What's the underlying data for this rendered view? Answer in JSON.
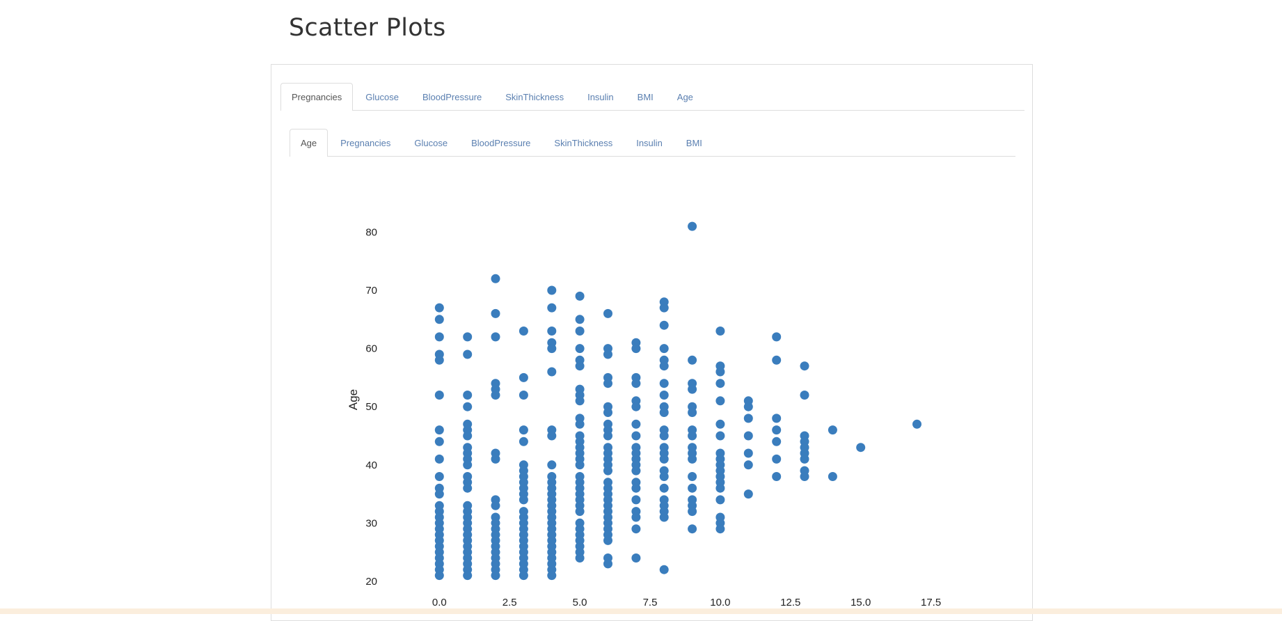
{
  "page": {
    "title": "Scatter Plots"
  },
  "outer_tabs": [
    {
      "label": "Pregnancies",
      "active": true
    },
    {
      "label": "Glucose",
      "active": false
    },
    {
      "label": "BloodPressure",
      "active": false
    },
    {
      "label": "SkinThickness",
      "active": false
    },
    {
      "label": "Insulin",
      "active": false
    },
    {
      "label": "BMI",
      "active": false
    },
    {
      "label": "Age",
      "active": false
    }
  ],
  "inner_tabs": [
    {
      "label": "Age",
      "active": true
    },
    {
      "label": "Pregnancies",
      "active": false
    },
    {
      "label": "Glucose",
      "active": false
    },
    {
      "label": "BloodPressure",
      "active": false
    },
    {
      "label": "SkinThickness",
      "active": false
    },
    {
      "label": "Insulin",
      "active": false
    },
    {
      "label": "BMI",
      "active": false
    }
  ],
  "colors": {
    "point": "#3a7dbd",
    "tab_link": "#5a7fb0",
    "bottom_strip": "#fbeedd"
  },
  "chart_data": {
    "type": "scatter",
    "title": "",
    "xlabel": "",
    "ylabel": "Age",
    "xlim": [
      -0.9,
      18.5
    ],
    "ylim": [
      17,
      84
    ],
    "x_ticks": [
      "0.0",
      "2.5",
      "5.0",
      "7.5",
      "10.0",
      "12.5",
      "15.0",
      "17.5"
    ],
    "x_tick_values": [
      0,
      2.5,
      5,
      7.5,
      10,
      12.5,
      15,
      17.5
    ],
    "y_ticks": [
      "20",
      "30",
      "40",
      "50",
      "60",
      "70",
      "80"
    ],
    "y_tick_values": [
      20,
      30,
      40,
      50,
      60,
      70,
      80
    ],
    "grid": false,
    "series": [
      {
        "points": [
          [
            0,
            67
          ],
          [
            0,
            65
          ],
          [
            0,
            62
          ],
          [
            0,
            59
          ],
          [
            0,
            58
          ],
          [
            0,
            52
          ],
          [
            0,
            46
          ],
          [
            0,
            44
          ],
          [
            0,
            41
          ],
          [
            0,
            38
          ],
          [
            0,
            36
          ],
          [
            0,
            35
          ],
          [
            0,
            33
          ],
          [
            0,
            32
          ],
          [
            0,
            31
          ],
          [
            0,
            30
          ],
          [
            0,
            29
          ],
          [
            0,
            28
          ],
          [
            0,
            27
          ],
          [
            0,
            26
          ],
          [
            0,
            25
          ],
          [
            0,
            24
          ],
          [
            0,
            23
          ],
          [
            0,
            22
          ],
          [
            0,
            21
          ],
          [
            1,
            62
          ],
          [
            1,
            59
          ],
          [
            1,
            52
          ],
          [
            1,
            50
          ],
          [
            1,
            47
          ],
          [
            1,
            46
          ],
          [
            1,
            45
          ],
          [
            1,
            43
          ],
          [
            1,
            42
          ],
          [
            1,
            41
          ],
          [
            1,
            40
          ],
          [
            1,
            38
          ],
          [
            1,
            37
          ],
          [
            1,
            36
          ],
          [
            1,
            33
          ],
          [
            1,
            32
          ],
          [
            1,
            31
          ],
          [
            1,
            30
          ],
          [
            1,
            29
          ],
          [
            1,
            28
          ],
          [
            1,
            27
          ],
          [
            1,
            26
          ],
          [
            1,
            25
          ],
          [
            1,
            24
          ],
          [
            1,
            23
          ],
          [
            1,
            22
          ],
          [
            1,
            21
          ],
          [
            2,
            72
          ],
          [
            2,
            66
          ],
          [
            2,
            62
          ],
          [
            2,
            54
          ],
          [
            2,
            53
          ],
          [
            2,
            52
          ],
          [
            2,
            42
          ],
          [
            2,
            41
          ],
          [
            2,
            34
          ],
          [
            2,
            33
          ],
          [
            2,
            31
          ],
          [
            2,
            30
          ],
          [
            2,
            29
          ],
          [
            2,
            28
          ],
          [
            2,
            27
          ],
          [
            2,
            26
          ],
          [
            2,
            25
          ],
          [
            2,
            24
          ],
          [
            2,
            23
          ],
          [
            2,
            22
          ],
          [
            2,
            21
          ],
          [
            3,
            63
          ],
          [
            3,
            55
          ],
          [
            3,
            52
          ],
          [
            3,
            46
          ],
          [
            3,
            44
          ],
          [
            3,
            40
          ],
          [
            3,
            39
          ],
          [
            3,
            38
          ],
          [
            3,
            37
          ],
          [
            3,
            36
          ],
          [
            3,
            35
          ],
          [
            3,
            34
          ],
          [
            3,
            32
          ],
          [
            3,
            31
          ],
          [
            3,
            30
          ],
          [
            3,
            29
          ],
          [
            3,
            28
          ],
          [
            3,
            27
          ],
          [
            3,
            26
          ],
          [
            3,
            25
          ],
          [
            3,
            24
          ],
          [
            3,
            23
          ],
          [
            3,
            22
          ],
          [
            3,
            21
          ],
          [
            4,
            70
          ],
          [
            4,
            67
          ],
          [
            4,
            63
          ],
          [
            4,
            61
          ],
          [
            4,
            60
          ],
          [
            4,
            56
          ],
          [
            4,
            46
          ],
          [
            4,
            45
          ],
          [
            4,
            40
          ],
          [
            4,
            38
          ],
          [
            4,
            37
          ],
          [
            4,
            36
          ],
          [
            4,
            35
          ],
          [
            4,
            34
          ],
          [
            4,
            33
          ],
          [
            4,
            32
          ],
          [
            4,
            31
          ],
          [
            4,
            30
          ],
          [
            4,
            29
          ],
          [
            4,
            28
          ],
          [
            4,
            27
          ],
          [
            4,
            26
          ],
          [
            4,
            25
          ],
          [
            4,
            24
          ],
          [
            4,
            23
          ],
          [
            4,
            22
          ],
          [
            4,
            21
          ],
          [
            5,
            69
          ],
          [
            5,
            65
          ],
          [
            5,
            63
          ],
          [
            5,
            60
          ],
          [
            5,
            58
          ],
          [
            5,
            57
          ],
          [
            5,
            53
          ],
          [
            5,
            52
          ],
          [
            5,
            51
          ],
          [
            5,
            48
          ],
          [
            5,
            47
          ],
          [
            5,
            45
          ],
          [
            5,
            44
          ],
          [
            5,
            43
          ],
          [
            5,
            42
          ],
          [
            5,
            41
          ],
          [
            5,
            40
          ],
          [
            5,
            38
          ],
          [
            5,
            37
          ],
          [
            5,
            36
          ],
          [
            5,
            35
          ],
          [
            5,
            34
          ],
          [
            5,
            33
          ],
          [
            5,
            32
          ],
          [
            5,
            30
          ],
          [
            5,
            29
          ],
          [
            5,
            28
          ],
          [
            5,
            27
          ],
          [
            5,
            26
          ],
          [
            5,
            25
          ],
          [
            5,
            24
          ],
          [
            6,
            66
          ],
          [
            6,
            60
          ],
          [
            6,
            59
          ],
          [
            6,
            55
          ],
          [
            6,
            54
          ],
          [
            6,
            50
          ],
          [
            6,
            49
          ],
          [
            6,
            47
          ],
          [
            6,
            46
          ],
          [
            6,
            45
          ],
          [
            6,
            43
          ],
          [
            6,
            42
          ],
          [
            6,
            41
          ],
          [
            6,
            40
          ],
          [
            6,
            39
          ],
          [
            6,
            37
          ],
          [
            6,
            36
          ],
          [
            6,
            35
          ],
          [
            6,
            34
          ],
          [
            6,
            33
          ],
          [
            6,
            32
          ],
          [
            6,
            31
          ],
          [
            6,
            30
          ],
          [
            6,
            29
          ],
          [
            6,
            28
          ],
          [
            6,
            27
          ],
          [
            6,
            24
          ],
          [
            6,
            23
          ],
          [
            7,
            61
          ],
          [
            7,
            60
          ],
          [
            7,
            55
          ],
          [
            7,
            54
          ],
          [
            7,
            51
          ],
          [
            7,
            50
          ],
          [
            7,
            47
          ],
          [
            7,
            45
          ],
          [
            7,
            43
          ],
          [
            7,
            42
          ],
          [
            7,
            41
          ],
          [
            7,
            40
          ],
          [
            7,
            39
          ],
          [
            7,
            37
          ],
          [
            7,
            36
          ],
          [
            7,
            34
          ],
          [
            7,
            32
          ],
          [
            7,
            31
          ],
          [
            7,
            29
          ],
          [
            7,
            24
          ],
          [
            8,
            68
          ],
          [
            8,
            67
          ],
          [
            8,
            64
          ],
          [
            8,
            60
          ],
          [
            8,
            58
          ],
          [
            8,
            57
          ],
          [
            8,
            54
          ],
          [
            8,
            52
          ],
          [
            8,
            50
          ],
          [
            8,
            49
          ],
          [
            8,
            46
          ],
          [
            8,
            45
          ],
          [
            8,
            43
          ],
          [
            8,
            42
          ],
          [
            8,
            41
          ],
          [
            8,
            39
          ],
          [
            8,
            38
          ],
          [
            8,
            36
          ],
          [
            8,
            34
          ],
          [
            8,
            33
          ],
          [
            8,
            32
          ],
          [
            8,
            31
          ],
          [
            8,
            22
          ],
          [
            9,
            81
          ],
          [
            9,
            58
          ],
          [
            9,
            54
          ],
          [
            9,
            53
          ],
          [
            9,
            50
          ],
          [
            9,
            49
          ],
          [
            9,
            46
          ],
          [
            9,
            45
          ],
          [
            9,
            43
          ],
          [
            9,
            42
          ],
          [
            9,
            41
          ],
          [
            9,
            38
          ],
          [
            9,
            36
          ],
          [
            9,
            34
          ],
          [
            9,
            33
          ],
          [
            9,
            32
          ],
          [
            9,
            29
          ],
          [
            10,
            63
          ],
          [
            10,
            57
          ],
          [
            10,
            56
          ],
          [
            10,
            54
          ],
          [
            10,
            51
          ],
          [
            10,
            47
          ],
          [
            10,
            45
          ],
          [
            10,
            42
          ],
          [
            10,
            41
          ],
          [
            10,
            40
          ],
          [
            10,
            39
          ],
          [
            10,
            38
          ],
          [
            10,
            37
          ],
          [
            10,
            36
          ],
          [
            10,
            34
          ],
          [
            10,
            31
          ],
          [
            10,
            30
          ],
          [
            10,
            29
          ],
          [
            11,
            51
          ],
          [
            11,
            50
          ],
          [
            11,
            48
          ],
          [
            11,
            45
          ],
          [
            11,
            42
          ],
          [
            11,
            40
          ],
          [
            11,
            35
          ],
          [
            12,
            62
          ],
          [
            12,
            58
          ],
          [
            12,
            48
          ],
          [
            12,
            46
          ],
          [
            12,
            44
          ],
          [
            12,
            41
          ],
          [
            12,
            38
          ],
          [
            13,
            57
          ],
          [
            13,
            52
          ],
          [
            13,
            45
          ],
          [
            13,
            44
          ],
          [
            13,
            43
          ],
          [
            13,
            42
          ],
          [
            13,
            41
          ],
          [
            13,
            39
          ],
          [
            13,
            38
          ],
          [
            14,
            46
          ],
          [
            14,
            38
          ],
          [
            15,
            43
          ],
          [
            17,
            47
          ]
        ]
      }
    ]
  }
}
